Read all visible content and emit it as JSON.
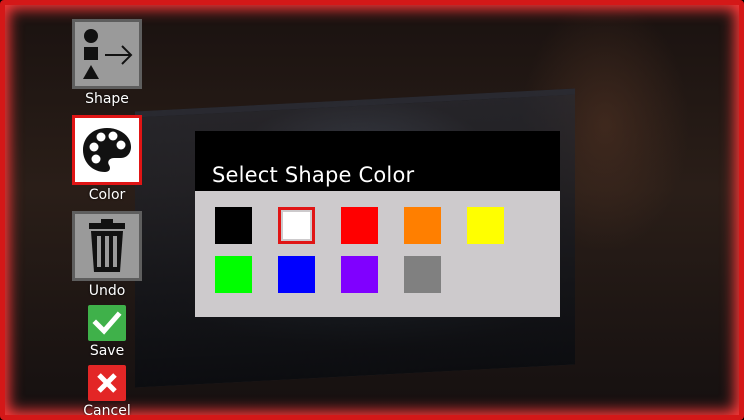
{
  "toolbar": {
    "shape_label": "Shape",
    "color_label": "Color",
    "undo_label": "Undo",
    "save_label": "Save",
    "cancel_label": "Cancel",
    "icons": {
      "shape": "shape-arrow-icon",
      "color": "palette-icon",
      "undo": "trash-icon",
      "save": "checkmark-icon",
      "cancel": "x-icon"
    }
  },
  "dialog": {
    "title": "Select Shape Color",
    "selected_color": "#ffffff",
    "colors": [
      {
        "name": "black",
        "hex": "#000000"
      },
      {
        "name": "white",
        "hex": "#ffffff"
      },
      {
        "name": "red",
        "hex": "#ff0000"
      },
      {
        "name": "orange",
        "hex": "#ff7f00"
      },
      {
        "name": "yellow",
        "hex": "#ffff00"
      },
      {
        "name": "green",
        "hex": "#00ff00"
      },
      {
        "name": "blue",
        "hex": "#0000ff"
      },
      {
        "name": "purple",
        "hex": "#8000ff"
      },
      {
        "name": "gray",
        "hex": "#808080"
      }
    ]
  },
  "accent_colors": {
    "frame": "#d41818",
    "save": "#3fb14a",
    "cancel": "#e32626"
  }
}
